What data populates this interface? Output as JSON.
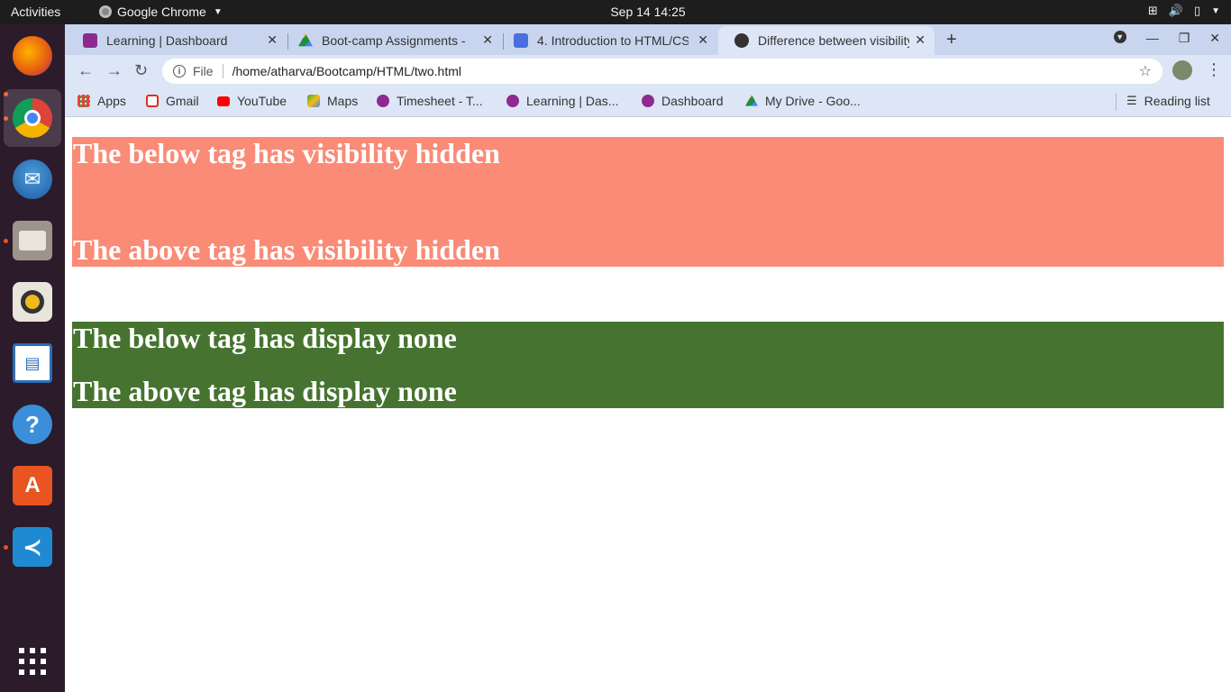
{
  "system": {
    "activities": "Activities",
    "app_name": "Google Chrome",
    "clock": "Sep 14  14:25"
  },
  "tabs": [
    {
      "title": "Learning | Dashboard",
      "favicon_color": "#8e2a8f"
    },
    {
      "title": "Boot-camp Assignments -",
      "favicon_color": "#1e8e3e"
    },
    {
      "title": "4. Introduction to HTML/CSS",
      "favicon_color": "#4a6ee0"
    },
    {
      "title": "Difference between visibility",
      "favicon_color": "#333333"
    }
  ],
  "toolbar": {
    "scheme": "File",
    "url": "/home/atharva/Bootcamp/HTML/two.html"
  },
  "bookmarks": [
    {
      "label": "Apps",
      "icon": "apps-grid-icon"
    },
    {
      "label": "Gmail",
      "icon": "gmail-icon"
    },
    {
      "label": "YouTube",
      "icon": "youtube-icon"
    },
    {
      "label": "Maps",
      "icon": "maps-icon"
    },
    {
      "label": "Timesheet - T...",
      "icon": "timesheet-icon"
    },
    {
      "label": "Learning | Das...",
      "icon": "learning-icon"
    },
    {
      "label": "Dashboard",
      "icon": "dashboard-icon"
    },
    {
      "label": "My Drive - Goo...",
      "icon": "drive-icon"
    }
  ],
  "reading_list": "Reading list",
  "page": {
    "block1": {
      "top": "The below tag has visibility hidden",
      "bottom": "The above tag has visibility hidden",
      "color": "#fa8b76"
    },
    "block2": {
      "top": "The below tag has display none",
      "bottom": "The above tag has display none",
      "color": "#467430"
    }
  }
}
